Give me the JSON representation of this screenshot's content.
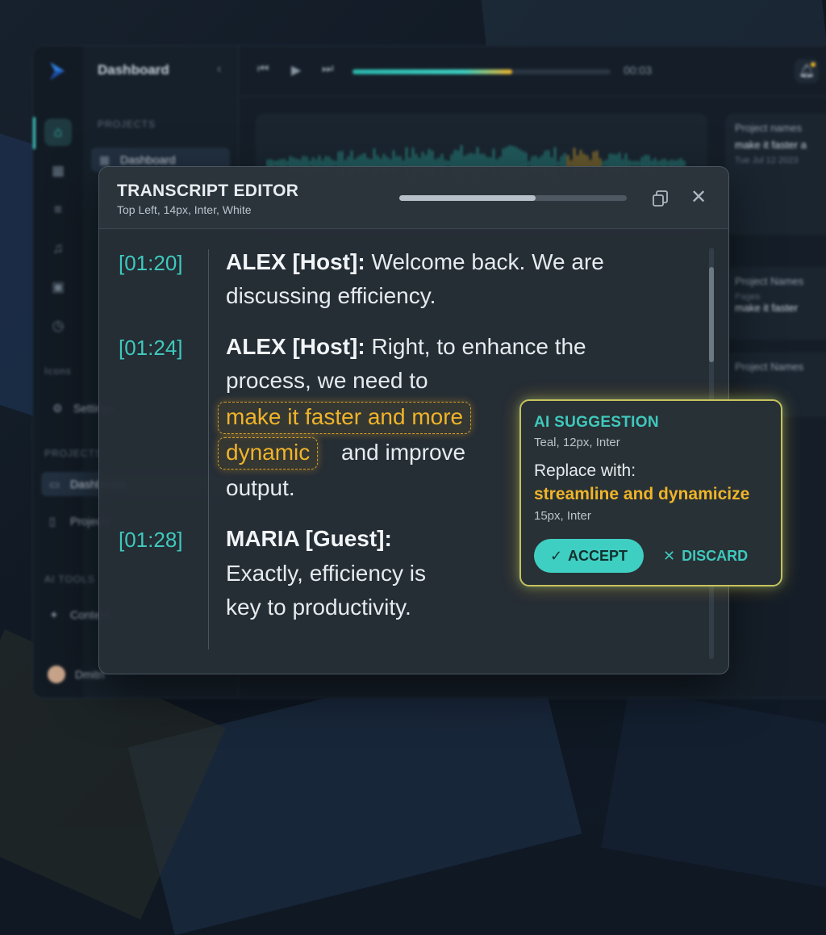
{
  "app": {
    "sidebar_title": "Dashboard",
    "sections": {
      "projects_top": "PROJECTS",
      "icons": "Icons",
      "projects": "PROJECTS",
      "ai_tools": "AI TOOLS"
    },
    "side_items": {
      "dashboard_top": "Dashboard",
      "settings": "Settings",
      "dashboard": "Dashboard",
      "projects": "Projects",
      "content": "Content"
    },
    "user_name": "Dmitri",
    "player_time": "00:03",
    "player_progress": 0.62,
    "right_panel": {
      "card1_heading": "Project names",
      "card1_text": "make it faster a",
      "card1_date": "Tue Jul 12 2023",
      "card2_heading": "Project Names",
      "card2_sub": "Pages",
      "card2_text": "make it faster",
      "card3_heading": "Project Names"
    }
  },
  "editor": {
    "title": "TRANSCRIPT EDITOR",
    "subtitle": "Top Left, 14px, Inter, White",
    "progress": 0.6,
    "entries": [
      {
        "timestamp": "[01:20]",
        "speaker": "ALEX [Host]:",
        "line1": "Welcome back. We are",
        "line2": "discussing efficiency."
      },
      {
        "timestamp": "[01:24]",
        "speaker": "ALEX [Host]:",
        "line1": "Right, to enhance the",
        "line2": "process, we need to",
        "highlight1": "make it faster and more",
        "highlight2": "dynamic",
        "after_highlight": "and improve",
        "line_end": "output."
      },
      {
        "timestamp": "[01:28]",
        "speaker": "MARIA [Guest]:",
        "line1": "Exactly, efficiency is",
        "line2": "key to productivity."
      }
    ]
  },
  "suggestion": {
    "title": "AI SUGGESTION",
    "meta": "Teal, 12px, Inter",
    "label": "Replace with:",
    "replacement": "streamline and dynamicize",
    "replacement_meta": "15px, Inter",
    "accept_label": "ACCEPT",
    "discard_label": "DISCARD"
  },
  "colors": {
    "accent_teal": "#3fc9bd",
    "highlight_amber": "#f0b429",
    "background": "#0f1823"
  },
  "icons": [
    "logo-icon",
    "home-icon",
    "grid-icon",
    "list-icon",
    "music-icon",
    "box-icon",
    "clock-icon",
    "gear-icon",
    "folder-icon",
    "file-icon",
    "sparkle-icon",
    "rewind-icon",
    "play-icon",
    "forward-icon",
    "bell-icon",
    "help-icon",
    "copy-icon",
    "close-icon",
    "check-icon",
    "x-icon"
  ]
}
